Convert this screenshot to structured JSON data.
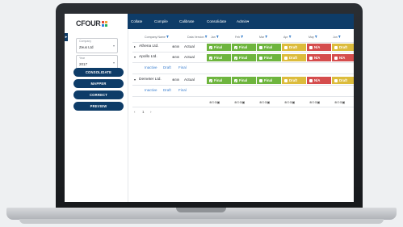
{
  "brand": {
    "logo_text": "CFOUR",
    "logo_colors": [
      "#e24a3b",
      "#f2a33a",
      "#2f7de1",
      "#27b05d"
    ]
  },
  "sidebar": {
    "company": {
      "label": "Company",
      "value": "Zeus Ltd"
    },
    "year": {
      "label": "Year",
      "value": "2017"
    },
    "buttons": {
      "consolidate": "CONSOLIDATE",
      "mapper": "MAPPER",
      "correct": "CORRECT",
      "preview": "PREVIEW"
    },
    "collapse_icon": "chevron-right-icon"
  },
  "nav": {
    "items": [
      "Collate",
      "Compile",
      "Calibrate",
      "Consolidate",
      "Admin"
    ]
  },
  "grid": {
    "headers": [
      "Company Name",
      "Data Version",
      "Jan",
      "Feb",
      "Mar",
      "Apr",
      "May",
      "Jun"
    ],
    "rows": [
      {
        "name": "Athena Ltd.",
        "version": "Actual",
        "statuses": [
          "Final",
          "Final",
          "Final",
          "Draft",
          "N/A",
          "Draft"
        ]
      },
      {
        "name": "Apollo Ltd.",
        "version": "Actual",
        "statuses": [
          "Final",
          "Final",
          "Final",
          "Draft",
          "N/A",
          "N/A"
        ]
      },
      {
        "name": "Demeter Ltd.",
        "version": "Actual",
        "statuses": [
          "Final",
          "Final",
          "Final",
          "Draft",
          "N/A",
          "Draft"
        ]
      }
    ],
    "sub_links": [
      "Inactive",
      "Draft",
      "Final"
    ],
    "pager": [
      "‹",
      "1",
      "›"
    ]
  },
  "colors": {
    "final": "#6eb53e",
    "draft": "#dcbc3c",
    "na": "#d54d4d",
    "nav_bg": "#0e3c68"
  }
}
